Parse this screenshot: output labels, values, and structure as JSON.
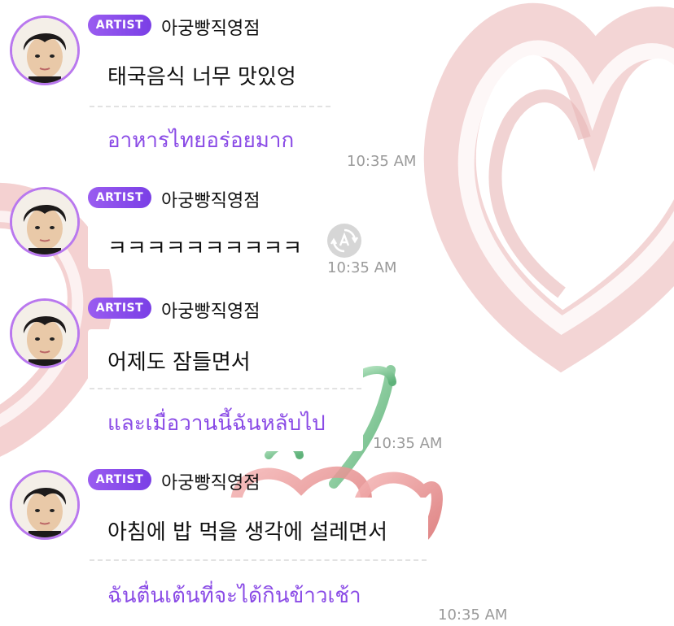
{
  "messages": [
    {
      "badge": "ARTIST",
      "sender": "아궁빵직영점",
      "text": "태국음식 너무 맛있엉",
      "translation": "อาหารไทยอร่อยมาก",
      "time": "10:35 AM"
    },
    {
      "badge": "ARTIST",
      "sender": "아궁빵직영점",
      "text": "ㅋㅋㅋㅋㅋㅋㅋㅋㅋㅋ",
      "translation": "",
      "time": "10:35 AM",
      "translate_icon": "translate-icon"
    },
    {
      "badge": "ARTIST",
      "sender": "아궁빵직영점",
      "text": "어제도 잠들면서",
      "translation": "และเมื่อวานนี้ฉันหลับไป",
      "time": "10:35 AM"
    },
    {
      "badge": "ARTIST",
      "sender": "아궁빵직영점",
      "text": "아침에 밥 먹을 생각에 설레면서",
      "translation": "ฉันตื่นเต้นที่จะได้กินข้าวเช้า",
      "time": "10:35 AM"
    }
  ],
  "colors": {
    "accent": "#8a4be6",
    "badge": "#8c4ff0",
    "avatar_ring": "#b978ee",
    "time": "#9a9a9a"
  }
}
